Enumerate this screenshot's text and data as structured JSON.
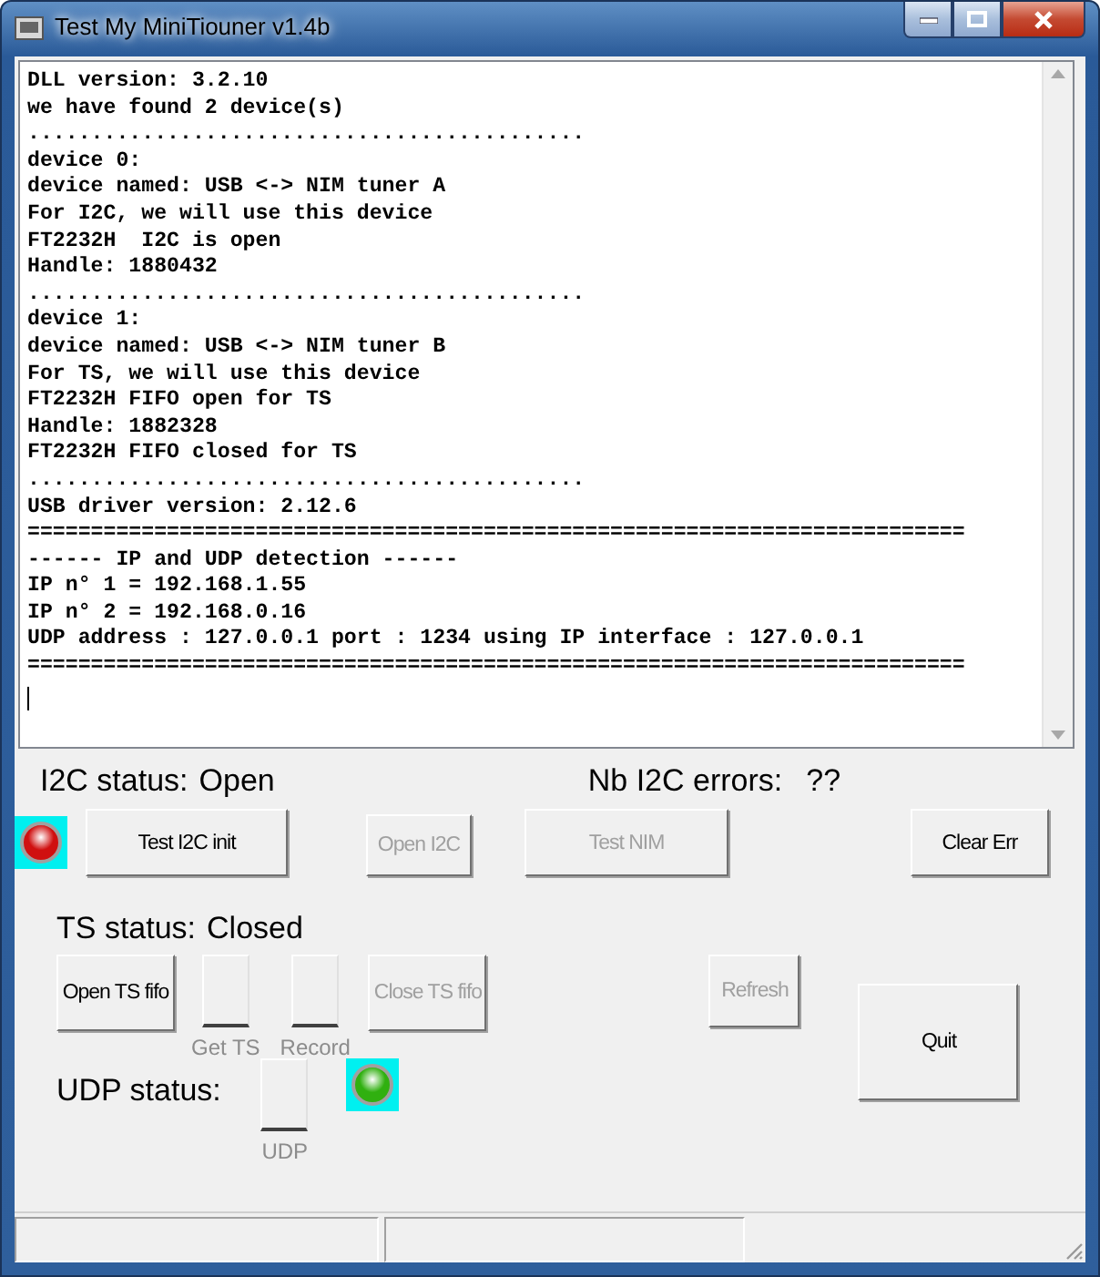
{
  "window": {
    "title": "Test My MiniTiouner v1.4b"
  },
  "log": {
    "lines": [
      "DLL version: 3.2.10",
      "we have found 2 device(s)",
      "............................................",
      "device 0:",
      "device named: USB <-> NIM tuner A",
      "For I2C, we will use this device",
      "FT2232H  I2C is open",
      "Handle: 1880432",
      "............................................",
      "device 1:",
      "device named: USB <-> NIM tuner B",
      "For TS, we will use this device",
      "FT2232H FIFO open for TS",
      "Handle: 1882328",
      "FT2232H FIFO closed for TS",
      "............................................",
      "USB driver version: 2.12.6",
      "==========================================================================",
      "------ IP and UDP detection ------",
      "IP n° 1 = 192.168.1.55",
      "IP n° 2 = 192.168.0.16",
      "UDP address : 127.0.0.1 port : 1234 using IP interface : 127.0.0.1",
      "=========================================================================="
    ]
  },
  "i2c": {
    "status_label": "I2C status:",
    "status": "Open",
    "errors_label": "Nb I2C errors:",
    "errors": "??",
    "led": {
      "color": "#d01010"
    },
    "buttons": [
      {
        "label": "Test I2C init",
        "disabled": false
      },
      {
        "label": "Open I2C",
        "disabled": true
      },
      {
        "label": "Test NIM",
        "disabled": true
      },
      {
        "label": "Clear Err",
        "disabled": false
      }
    ]
  },
  "ts": {
    "status_label": "TS status:",
    "status": "Closed",
    "buttons": [
      {
        "label": "Open TS fifo",
        "disabled": false
      },
      {
        "label": "Close TS fifo",
        "disabled": true
      },
      {
        "label": "Refresh",
        "disabled": true
      },
      {
        "label": "Quit",
        "disabled": false
      }
    ],
    "toggles": [
      {
        "label": "Get TS",
        "disabled": true
      },
      {
        "label": "Record",
        "disabled": true
      }
    ]
  },
  "udp": {
    "status_label": "UDP status:",
    "toggle": {
      "label": "UDP",
      "disabled": true
    },
    "led": {
      "color": "#30b010"
    }
  }
}
